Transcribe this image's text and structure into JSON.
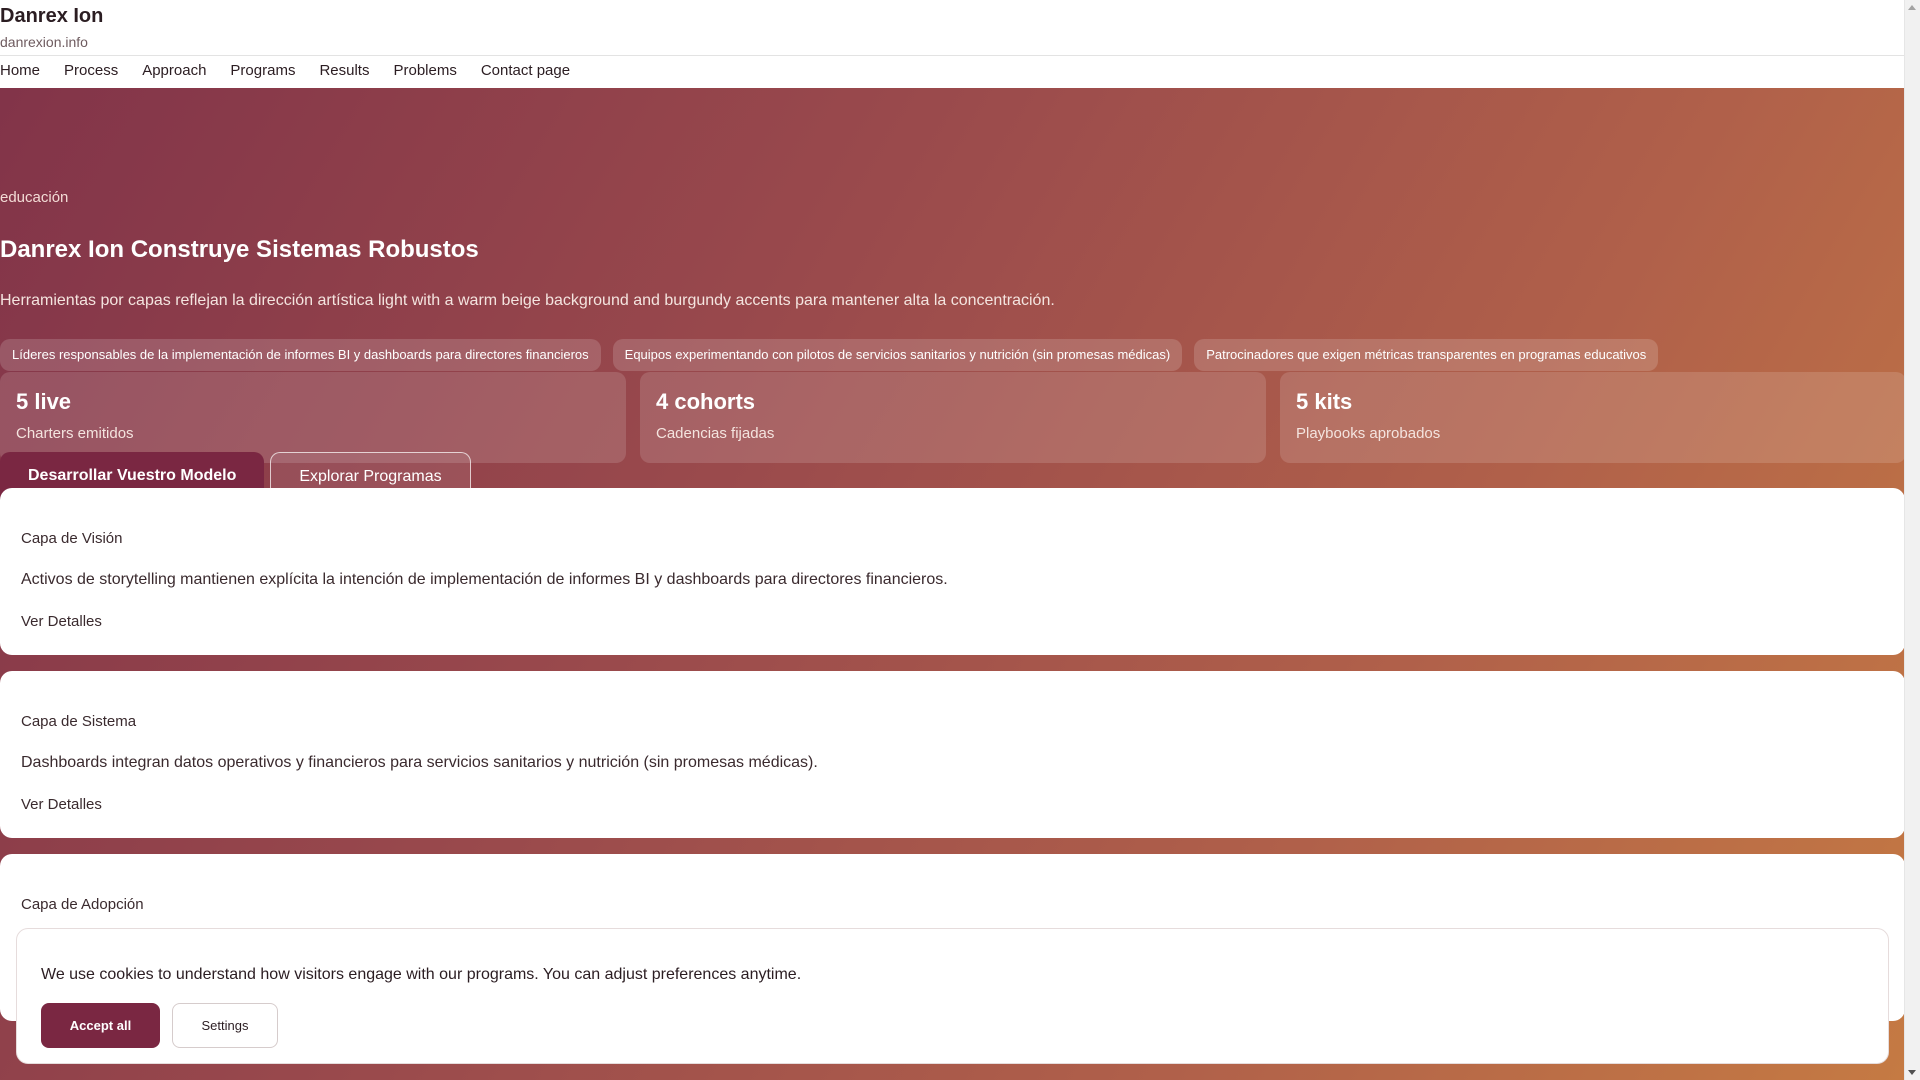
{
  "site": {
    "title": "Danrex Ion",
    "domain": "danrexion.info"
  },
  "nav": {
    "items": [
      {
        "label": "Home"
      },
      {
        "label": "Process"
      },
      {
        "label": "Approach"
      },
      {
        "label": "Programs"
      },
      {
        "label": "Results"
      },
      {
        "label": "Problems"
      },
      {
        "label": "Contact page"
      }
    ]
  },
  "hero": {
    "eyebrow": "educación",
    "title": "Danrex Ion Construye Sistemas Robustos",
    "subtitle": "Herramientas por capas reflejan la dirección artística light with a warm beige background and burgundy accents para mantener alta la concentración.",
    "chips": [
      "Líderes responsables de la implementación de informes BI y dashboards para directores financieros",
      "Equipos experimentando con pilotos de servicios sanitarios y nutrición (sin promesas médicas)",
      "Patrocinadores que exigen métricas transparentes en programas educativos"
    ],
    "stats": [
      {
        "value": "5 live",
        "label": "Charters emitidos"
      },
      {
        "value": "4 cohorts",
        "label": "Cadencias fijadas"
      },
      {
        "value": "5 kits",
        "label": "Playbooks aprobados"
      }
    ],
    "primary_cta": "Desarrollar Vuestro Modelo",
    "secondary_cta": "Explorar Programas"
  },
  "layers": [
    {
      "title": "Capa de Visión",
      "body": "Activos de storytelling mantienen explícita la intención de implementación de informes BI y dashboards para directores financieros.",
      "link": "Ver Detalles"
    },
    {
      "title": "Capa de Sistema",
      "body": "Dashboards integran datos operativos y financieros para servicios sanitarios y nutrición (sin promesas médicas).",
      "link": "Ver Detalles"
    },
    {
      "title": "Capa de Adopción"
    }
  ],
  "cookie": {
    "text": "We use cookies to understand how visitors engage with our programs. You can adjust preferences anytime.",
    "accept_label": "Accept all",
    "settings_label": "Settings"
  },
  "colors": {
    "accent": "#7a2742",
    "hero_gradient_start": "#823449",
    "hero_gradient_end": "#c57a43"
  }
}
